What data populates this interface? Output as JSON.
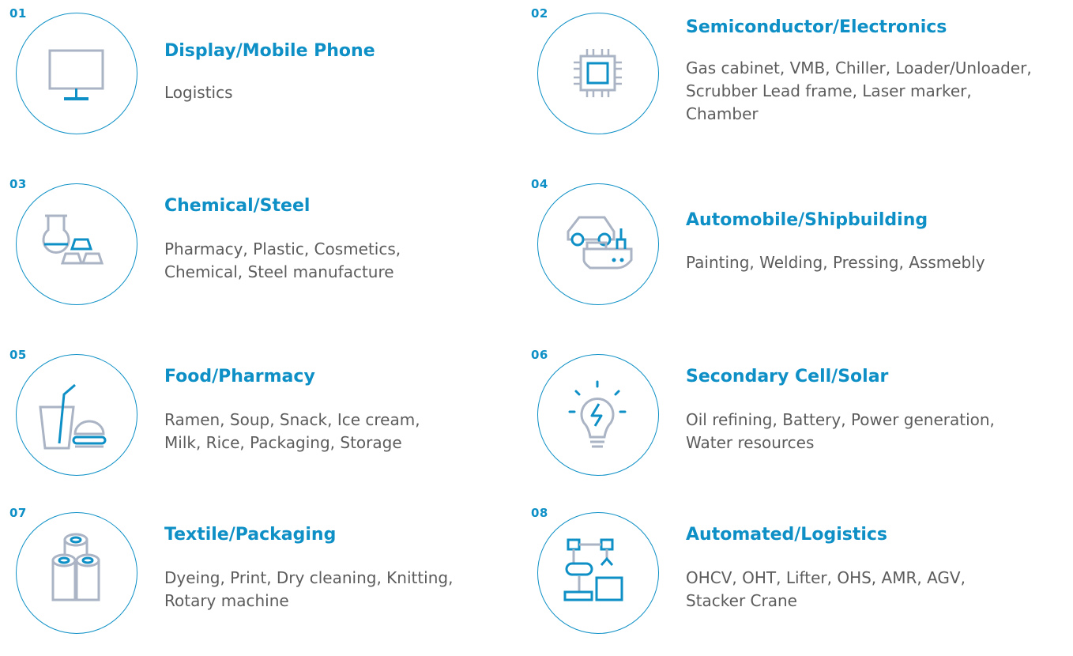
{
  "colors": {
    "accent": "#0e90c6",
    "icon_gray": "#aab4c4",
    "text": "#5c5c5c"
  },
  "industries": [
    {
      "number": "01",
      "title": "Display/Mobile Phone",
      "desc": [
        "Logistics"
      ],
      "icon": "monitor-icon"
    },
    {
      "number": "02",
      "title": "Semiconductor/Electronics",
      "desc": [
        "Gas cabinet, VMB, Chiller, Loader/Unloader,",
        "Scrubber Lead frame, Laser marker,",
        "Chamber"
      ],
      "icon": "chip-icon"
    },
    {
      "number": "03",
      "title": "Chemical/Steel",
      "desc": [
        "Pharmacy, Plastic, Cosmetics,",
        "Chemical, Steel manufacture"
      ],
      "icon": "flask-steel-icon"
    },
    {
      "number": "04",
      "title": "Automobile/Shipbuilding",
      "desc": [
        "Painting, Welding, Pressing, Assmebly"
      ],
      "icon": "car-ship-icon"
    },
    {
      "number": "05",
      "title": "Food/Pharmacy",
      "desc": [
        "Ramen, Soup, Snack, Ice cream,",
        "Milk, Rice, Packaging, Storage"
      ],
      "icon": "drink-burger-icon"
    },
    {
      "number": "06",
      "title": "Secondary Cell/Solar",
      "desc": [
        "Oil refining, Battery, Power generation,",
        "Water resources"
      ],
      "icon": "lightbulb-icon"
    },
    {
      "number": "07",
      "title": "Textile/Packaging",
      "desc": [
        "Dyeing, Print, Dry cleaning, Knitting,",
        "Rotary machine"
      ],
      "icon": "fabric-rolls-icon"
    },
    {
      "number": "08",
      "title": "Automated/Logistics",
      "desc": [
        "OHCV, OHT, Lifter, OHS, AMR, AGV,",
        "Stacker Crane"
      ],
      "icon": "robot-arm-icon"
    }
  ]
}
